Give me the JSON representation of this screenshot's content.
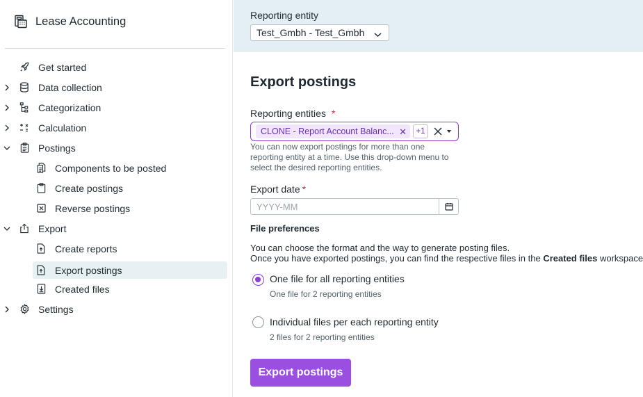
{
  "app": {
    "title": "Lease Accounting",
    "icon": "calculator-icon"
  },
  "sidebar": {
    "items": [
      {
        "label": "Get started",
        "icon": "rocket-icon",
        "expandable": false
      },
      {
        "label": "Data collection",
        "icon": "database-icon",
        "expandable": true,
        "expanded": false
      },
      {
        "label": "Categorization",
        "icon": "hierarchy-icon",
        "expandable": true,
        "expanded": false
      },
      {
        "label": "Calculation",
        "icon": "calculator-ops-icon",
        "expandable": true,
        "expanded": false
      },
      {
        "label": "Postings",
        "icon": "clipboard-icon",
        "expandable": true,
        "expanded": true,
        "children": [
          {
            "label": "Components to be posted",
            "icon": "documents-icon"
          },
          {
            "label": "Create postings",
            "icon": "clipboard-icon"
          },
          {
            "label": "Reverse postings",
            "icon": "reverse-box-icon"
          }
        ]
      },
      {
        "label": "Export",
        "icon": "export-icon",
        "expandable": true,
        "expanded": true,
        "children": [
          {
            "label": "Create reports",
            "icon": "file-export-icon"
          },
          {
            "label": "Export postings",
            "icon": "file-export-icon",
            "active": true
          },
          {
            "label": "Created files",
            "icon": "file-download-icon"
          }
        ]
      },
      {
        "label": "Settings",
        "icon": "gear-icon",
        "expandable": true,
        "expanded": false
      }
    ]
  },
  "topbar": {
    "reporting_entity_label": "Reporting entity",
    "reporting_entity_value": "Test_Gmbh - Test_Gmbh"
  },
  "page": {
    "title": "Export postings",
    "reporting_entities": {
      "label": "Reporting entities",
      "required_mark": "*",
      "chip": "CLONE - Report Account Balanc...",
      "more": "+1",
      "help": "You can now export postings for more than one reporting entity at a time. Use this drop-down menu to select the desired reporting entities."
    },
    "export_date": {
      "label": "Export date",
      "required_mark": "*",
      "value": "",
      "placeholder": "YYYY-MM"
    },
    "file_preferences": {
      "title": "File preferences",
      "desc_line1": "You can choose the format and the way to generate posting files.",
      "desc_line2_pre": "Once you have exported postings, you can find the respective files in the ",
      "desc_line2_bold": "Created files",
      "desc_line2_post": " workspace.",
      "options": [
        {
          "label": "One file for all reporting entities",
          "sub": "One file for 2 reporting entities",
          "checked": true
        },
        {
          "label": "Individual files per each reporting entity",
          "sub": "2 files for 2 reporting entities",
          "checked": false
        }
      ]
    },
    "submit_label": "Export postings"
  },
  "colors": {
    "accent": "#9b4fe0",
    "accent_dark": "#8a3fd1",
    "topbar_bg": "#e3eff2",
    "active_nav_bg": "#e7f1f3"
  }
}
